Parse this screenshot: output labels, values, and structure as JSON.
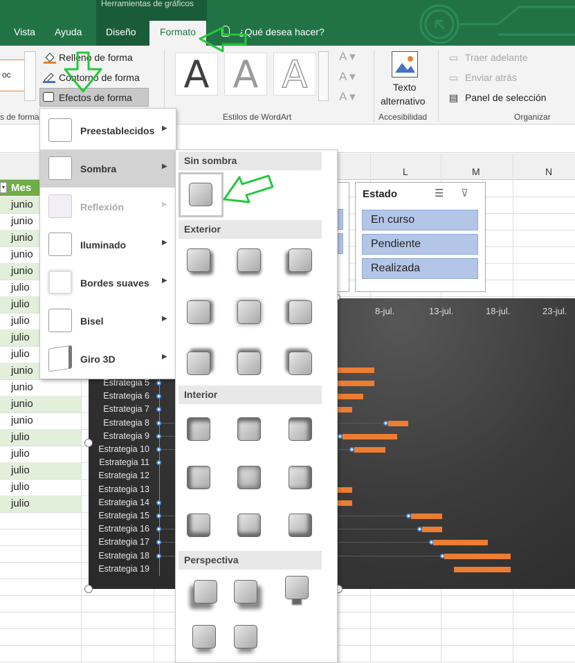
{
  "context_tab_title": "Herramientas de gráficos",
  "tabs": [
    "Vista",
    "Ayuda",
    "Diseño",
    "Formato"
  ],
  "tell_me": "¿Qué desea hacer?",
  "ribbon": {
    "shape_cmds": [
      "Relleno de forma",
      "Contorno de forma",
      "Efectos de forma"
    ],
    "group_shape_styles": "s de forma",
    "wordart_letter": "A",
    "group_wordart": "Estilos de WordArt",
    "alt_text": [
      "Texto",
      "alternativo"
    ],
    "group_accessibility": "Accesibilidad",
    "arrange": [
      "Traer adelante",
      "Enviar atrás",
      "Panel de selección"
    ],
    "group_arrange": "Organizar",
    "small_sample": "oc"
  },
  "columns": [
    "L",
    "M",
    "N"
  ],
  "mes_header": "Mes",
  "mes_values": [
    "junio",
    "junio",
    "junio",
    "junio",
    "junio",
    "julio",
    "julio",
    "julio",
    "julio",
    "julio",
    "junio",
    "junio",
    "junio",
    "junio",
    "julio",
    "julio",
    "julio",
    "julio",
    "julio"
  ],
  "slicer": {
    "title": "Estado",
    "items": [
      "En curso",
      "Pendiente",
      "Realizada"
    ]
  },
  "chart": {
    "dates": [
      "8-jul.",
      "13-jul.",
      "18-jul.",
      "23-jul."
    ],
    "strategies": [
      "Estrategia 5",
      "Estrategia 6",
      "Estrategia 7",
      "Estrategia 8",
      "Estrategia 9",
      "Estrategia 10",
      "Estrategia 11",
      "Estrategia 12",
      "Estrategia 13",
      "Estrategia 14",
      "Estrategia 15",
      "Estrategia 16",
      "Estrategia 17",
      "Estrategia 18",
      "Estrategia 19"
    ],
    "bar_color": "#ed7d31"
  },
  "effects_menu": [
    "Preestablecidos",
    "Sombra",
    "Reflexión",
    "Iluminado",
    "Bordes suaves",
    "Bisel",
    "Giro 3D"
  ],
  "shadow_menu": {
    "sections": [
      "Sin sombra",
      "Exterior",
      "Interior",
      "Perspectiva"
    ]
  },
  "colors": {
    "excel_green": "#217346",
    "annotation_green": "#22c83a",
    "accent_orange": "#ed7d31",
    "slicer_blue": "#b4c6e7"
  }
}
